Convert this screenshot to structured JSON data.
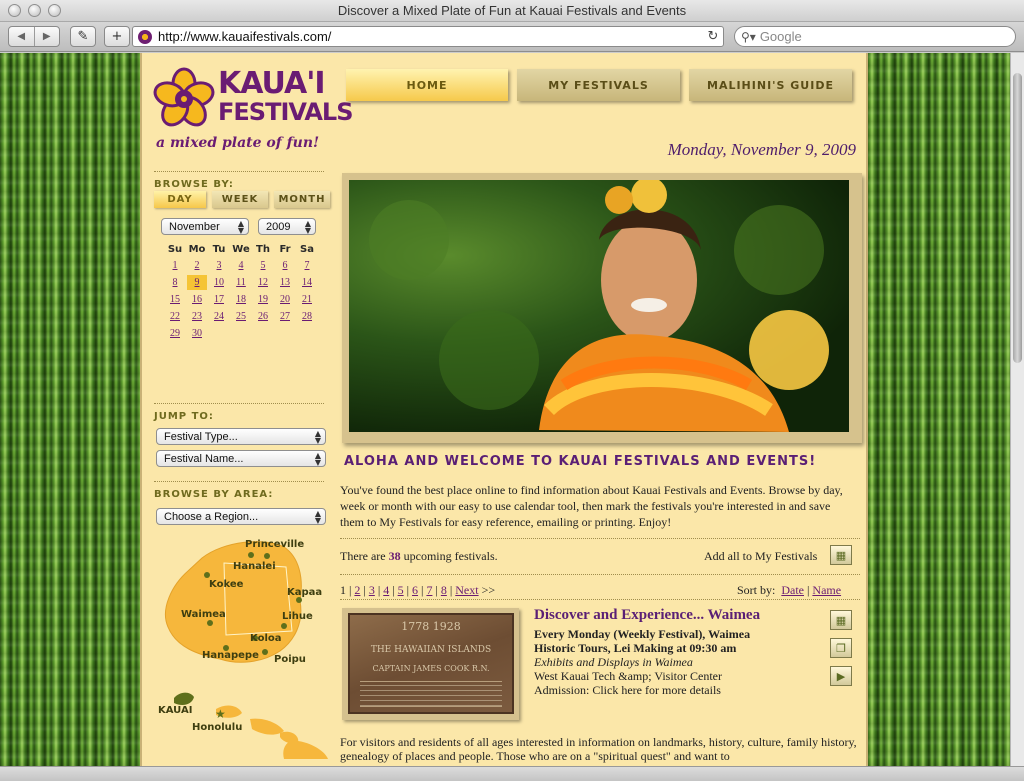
{
  "window": {
    "title": "Discover a Mixed Plate of Fun at Kauai Festivals and Events",
    "url": "http://www.kauaifestivals.com/",
    "search_placeholder": "Google"
  },
  "logo": {
    "line1": "KAUA'I",
    "line2": "FESTIVALS",
    "tagline": "a mixed plate of fun!"
  },
  "nav": {
    "tabs": [
      "HOME",
      "MY FESTIVALS",
      "MALIHINI'S GUIDE"
    ],
    "active": "HOME"
  },
  "date": "Monday, November 9, 2009",
  "sidebar": {
    "browse_by": "BROWSE BY:",
    "browse_tabs": [
      "DAY",
      "WEEK",
      "MONTH"
    ],
    "month": "November",
    "year": "2009",
    "weekdays": [
      "Su",
      "Mo",
      "Tu",
      "We",
      "Th",
      "Fr",
      "Sa"
    ],
    "weeks": [
      [
        "1",
        "2",
        "3",
        "4",
        "5",
        "6",
        "7"
      ],
      [
        "8",
        "9",
        "10",
        "11",
        "12",
        "13",
        "14"
      ],
      [
        "15",
        "16",
        "17",
        "18",
        "19",
        "20",
        "21"
      ],
      [
        "22",
        "23",
        "24",
        "25",
        "26",
        "27",
        "28"
      ],
      [
        "29",
        "30",
        "",
        "",
        "",
        "",
        ""
      ]
    ],
    "today": "9",
    "jump_to": "JUMP TO:",
    "festival_type": "Festival Type...",
    "festival_name": "Festival Name...",
    "browse_area": "BROWSE BY AREA:",
    "region": "Choose a Region...",
    "map_labels": [
      "Princeville",
      "Hanalei",
      "Kokee",
      "Kapaa",
      "Waimea",
      "Lihue",
      "Koloa",
      "Hanapepe",
      "Poipu",
      "KAUAI",
      "Honolulu"
    ]
  },
  "hero": {
    "icons": {
      "photo": "hula-dancer-photo"
    }
  },
  "main": {
    "welcome": "ALOHA AND WELCOME TO KAUAI FESTIVALS AND EVENTS!",
    "intro": "You've found the best place online to find information about Kauai Festivals and Events. Browse by day, week or month with our easy to use calendar tool, then mark the festivals you're interested in and save them to My Festivals for easy reference, emailing or printing. Enjoy!",
    "upcoming_pre": "There are",
    "upcoming_count": "38",
    "upcoming_post": "upcoming festivals.",
    "add_all": "Add all to My Festivals",
    "pages": [
      "1",
      "2",
      "3",
      "4",
      "5",
      "6",
      "7",
      "8"
    ],
    "next": "Next",
    "next_arrows": ">>",
    "sort_by": "Sort by:",
    "sort_date": "Date",
    "sort_name": "Name"
  },
  "event": {
    "title": "Discover and Experience... Waimea",
    "schedule": "Every Monday (Weekly Festival), Waimea",
    "tour": "Historic Tours, Lei Making at 09:30 am",
    "category": "Exhibits and Displays in Waimea",
    "venue": "West Kauai Tech &amp; Visitor Center",
    "admission": "Admission: Click here for more details",
    "plaque_lines": [
      "1778   1928",
      "THE HAWAIIAN ISLANDS",
      "CAPTAIN JAMES COOK R.N."
    ],
    "description": "For visitors and residents of all ages interested in information on landmarks, history, culture, family history, genealogy of places and people. Those who are on a \"spiritual quest\" and want to"
  },
  "colors": {
    "purple": "#6a1c73",
    "gold": "#f6c94b",
    "page_bg": "#fbe7a9"
  }
}
